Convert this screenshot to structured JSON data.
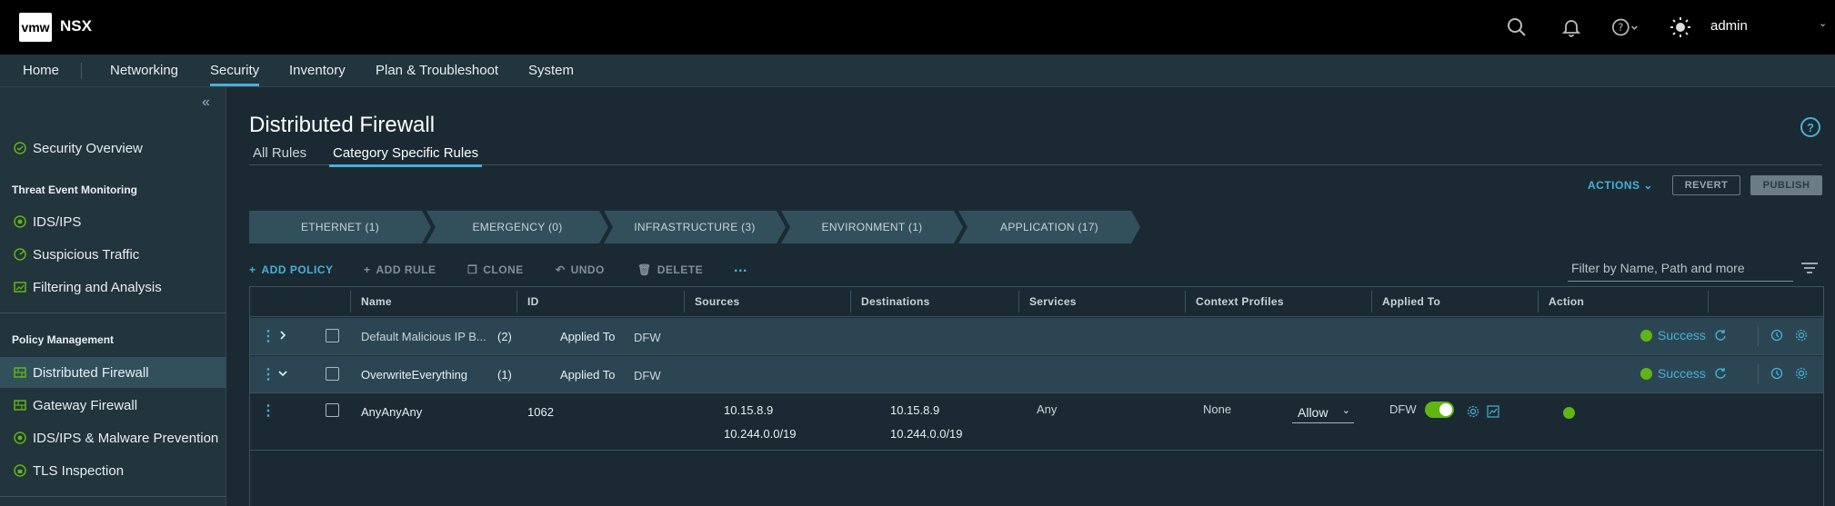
{
  "app": {
    "logo_text": "vmw",
    "name": "NSX",
    "user": "admin"
  },
  "nav": {
    "items": [
      "Home",
      "Networking",
      "Security",
      "Inventory",
      "Plan & Troubleshoot",
      "System"
    ],
    "active": "Security"
  },
  "sidebar": {
    "security_overview": "Security Overview",
    "threat_heading": "Threat Event Monitoring",
    "threat_items": [
      "IDS/IPS",
      "Suspicious Traffic",
      "Filtering and Analysis"
    ],
    "policy_heading": "Policy Management",
    "policy_items": [
      "Distributed Firewall",
      "Gateway Firewall",
      "IDS/IPS & Malware Prevention",
      "TLS Inspection"
    ],
    "active": "Distributed Firewall"
  },
  "page": {
    "title": "Distributed Firewall",
    "help_label": "?",
    "tabs": [
      "All Rules",
      "Category Specific Rules"
    ],
    "active_tab": "Category Specific Rules",
    "actions_label": "ACTIONS",
    "revert_label": "REVERT",
    "publish_label": "PUBLISH"
  },
  "categories": [
    "ETHERNET (1)",
    "EMERGENCY (0)",
    "INFRASTRUCTURE (3)",
    "ENVIRONMENT (1)",
    "APPLICATION (17)"
  ],
  "toolbar": {
    "add_policy": "ADD POLICY",
    "add_rule": "ADD RULE",
    "clone": "CLONE",
    "undo": "UNDO",
    "delete": "DELETE",
    "more": "...",
    "filter_placeholder": "Filter by Name, Path and more"
  },
  "table": {
    "columns": [
      "Name",
      "ID",
      "Sources",
      "Destinations",
      "Services",
      "Context Profiles",
      "Applied To",
      "Action"
    ],
    "policies": [
      {
        "name": "Default Malicious IP B...",
        "count": "(2)",
        "applied_label": "Applied To",
        "applied_value": "DFW",
        "status": "Success",
        "expanded": false
      },
      {
        "name": "OverwriteEverything",
        "count": "(1)",
        "applied_label": "Applied To",
        "applied_value": "DFW",
        "status": "Success",
        "expanded": true
      }
    ],
    "rule": {
      "name": "AnyAnyAny",
      "id": "1062",
      "sources": [
        "10.15.8.9",
        "10.244.0.0/19"
      ],
      "destinations": [
        "10.15.8.9",
        "10.244.0.0/19"
      ],
      "services": "Any",
      "context_profiles": "None",
      "applied_to": "DFW",
      "action": "Allow",
      "enabled": true
    }
  },
  "colors": {
    "accent": "#49afd9",
    "success": "#60b515",
    "header_bg": "#000000",
    "nav_bg": "#22343c",
    "body_bg": "#1b2a32",
    "row_bg": "#2b4652"
  }
}
